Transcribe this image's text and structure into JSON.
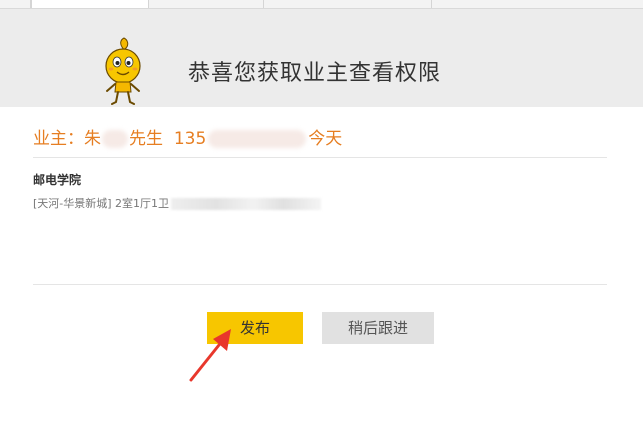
{
  "header": {
    "title": "恭喜您获取业主查看权限"
  },
  "owner": {
    "prefix": "业主：朱",
    "title": "先生",
    "phone_prefix": "135",
    "date": "今天"
  },
  "house": {
    "name": "邮电学院",
    "detail": "[天河-华景新城] 2室1厅1卫"
  },
  "buttons": {
    "publish": "发布",
    "later": "稍后跟进"
  },
  "colors": {
    "accent": "#f7c600",
    "owner_text": "#e67e22",
    "arrow": "#e8372c",
    "header_bg": "#ececec"
  },
  "icons": {
    "mascot": "mascot-icon",
    "annotation": "red-arrow-annotation"
  }
}
